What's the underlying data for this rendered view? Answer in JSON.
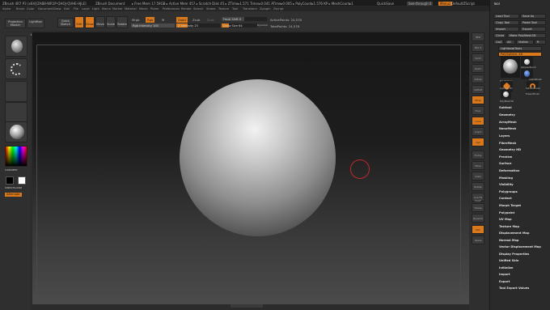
{
  "titlebar": {
    "app": "ZBrush 4R7 P3 (x64)[ZAB8-WR1P-QHOJ-QVHE-HJLE]",
    "doc": "ZBrush Document",
    "mem": "▸ Free Mem 17.59GB ▸ Active Mem 457 ▸ Scratch Disk 45 ▸ ZTime▸1.571 Timer▸0.041 ATime▸0.005 ▸ PolyCount▸1.576 KP ▸ MeshCount▸1",
    "quicksave": "QuickSave",
    "seethrough": "See-through  0",
    "menus": "Menus",
    "defaultzscript": "DefaultZScript"
  },
  "menubar": {
    "items": [
      "Alpha",
      "Brush",
      "Color",
      "Document",
      "Draw",
      "Edit",
      "File",
      "Layer",
      "Light",
      "Macro",
      "Marker",
      "Material",
      "Movie",
      "Picker",
      "Preferences",
      "Render",
      "Stencil",
      "Stroke",
      "Texture",
      "Tool",
      "Transform",
      "Zplugin",
      "Zscript"
    ]
  },
  "shelf": {
    "projection_master": "Projection Master",
    "lightbox": "LightBox",
    "quick_sketch": "Quick Sketch",
    "edit": "Edit",
    "draw": "Draw",
    "move": "Move",
    "scale": "Scale",
    "rotate": "Rotate",
    "mrgb": "Mrgb",
    "rgb": "Rgb",
    "m": "M",
    "zadd": "Zadd",
    "zsub": "Zsub",
    "zcut": "Zcut",
    "rgb_intensity": "Rgb Intensity 100",
    "z_intensity": "Z Intensity 25",
    "focal_shift": "Focal Shift 0",
    "draw_size": "Draw Size 64",
    "dynamic": "Dynamic",
    "active_points": "ActivePoints: 24,578",
    "total_points": "TotalPoints: 24,578"
  },
  "coords": "0.907,0.874,0.75",
  "lefttray": {
    "gradient": "Gradient",
    "switchcolor": "SwitchColor",
    "alternate": "Alternate"
  },
  "righttools": [
    "BPR",
    "SPix 3",
    "Scroll",
    "Zoom",
    "Actual",
    "AAHalf",
    "Persp",
    "Floor",
    "Local",
    "L.Sym",
    "Gyz",
    "Frame",
    "Move",
    "Scale",
    "Rotate",
    "Line Fill PolyF",
    "Transp",
    "Dynamic",
    "Solo",
    "Xpose"
  ],
  "palette": {
    "title": "Tool",
    "load_tool": "Load Tool",
    "save_as": "Save As",
    "copy_tool": "Copy Tool",
    "paste_tool": "Paste Tool",
    "import": "Import",
    "export": "Export",
    "clone": "Clone",
    "make_polymesh": "Make PolyMesh3D",
    "goz": "GoZ",
    "all": "All",
    "visible": "Visible",
    "r": "R",
    "lightbox_tools": "Lightbox▸Tools",
    "polysphere": "PolySphere. 48",
    "tools": [
      "PolySphere",
      "Simple Brush",
      "Cylinder3D",
      "PolyMesh3D",
      "SphereBrush",
      "AlphaBrush",
      "EraserBrush"
    ],
    "subpalettes": [
      "Subtool",
      "Geometry",
      "ArrayMesh",
      "NanoMesh",
      "Layers",
      "FiberMesh",
      "Geometry HD",
      "Preview",
      "Surface",
      "Deformation",
      "Masking",
      "Visibility",
      "Polygroups",
      "Contact",
      "Morph Target",
      "Polypaint",
      "UV Map",
      "Texture Map",
      "Displacement Map",
      "Normal Map",
      "Vector Displacement Map",
      "Display Properties",
      "Unified Skin",
      "Initialize",
      "Import",
      "Export",
      "Tool Export Values"
    ]
  },
  "colors": {
    "accent": "#d9791b",
    "brush_cursor": "#c0282b"
  }
}
